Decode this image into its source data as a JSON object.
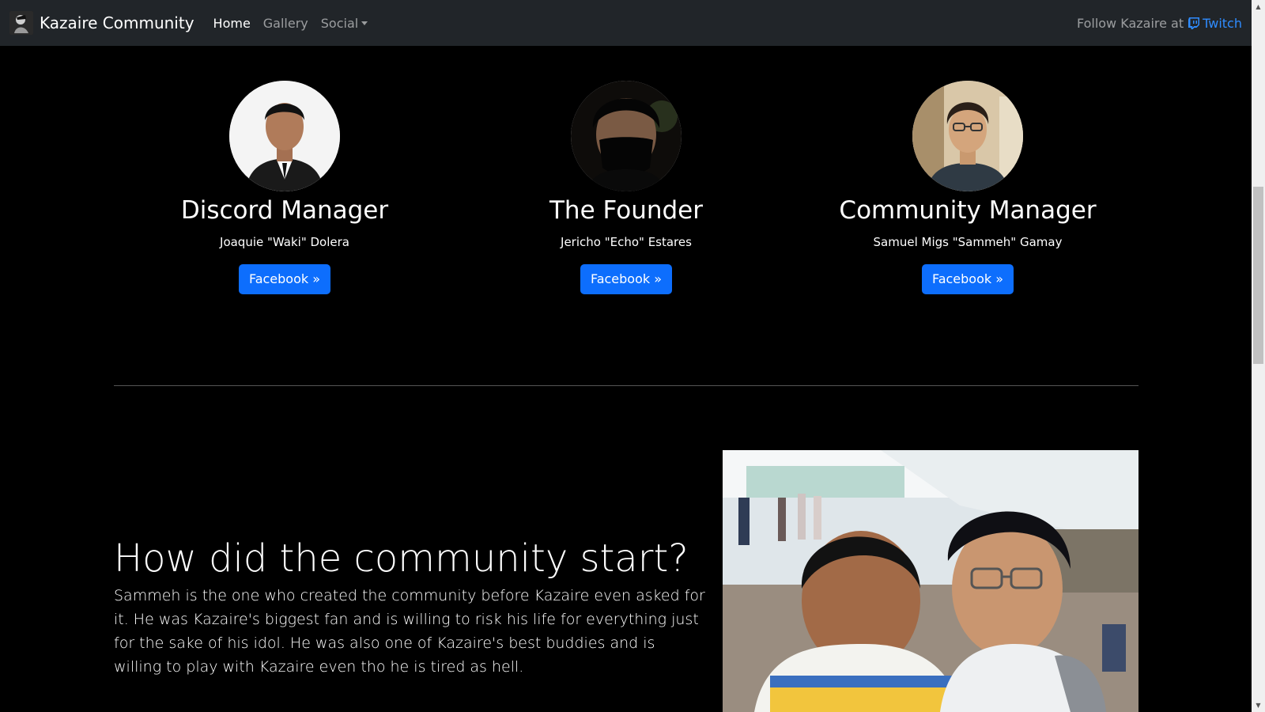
{
  "navbar": {
    "brand": "Kazaire Community",
    "links": [
      {
        "label": "Home",
        "active": true
      },
      {
        "label": "Gallery",
        "active": false
      },
      {
        "label": "Social",
        "active": false,
        "dropdown": true
      }
    ],
    "follow_text": "Follow Kazaire at",
    "twitch_label": "Twitch",
    "twitch_icon": "twitch-icon"
  },
  "team": [
    {
      "role": "Discord Manager",
      "name": "Joaquie \"Waki\" Dolera",
      "button": "Facebook »"
    },
    {
      "role": "The Founder",
      "name": "Jericho \"Echo\" Estares",
      "button": "Facebook »"
    },
    {
      "role": "Community Manager",
      "name": "Samuel Migs \"Sammeh\" Gamay",
      "button": "Facebook »"
    }
  ],
  "feature": {
    "heading": "How did the community start?",
    "body": "Sammeh is the one who created the community before Kazaire even asked for it. He was Kazaire's biggest fan and is willing to risk his life for everything just for the sake of his idol. He was also one of Kazaire's best buddies and is willing to play with Kazaire even tho he is tired as hell."
  },
  "colors": {
    "background": "#000000",
    "navbar": "#212529",
    "primary_button": "#0d6efd",
    "twitch_link": "#2f8cff"
  }
}
